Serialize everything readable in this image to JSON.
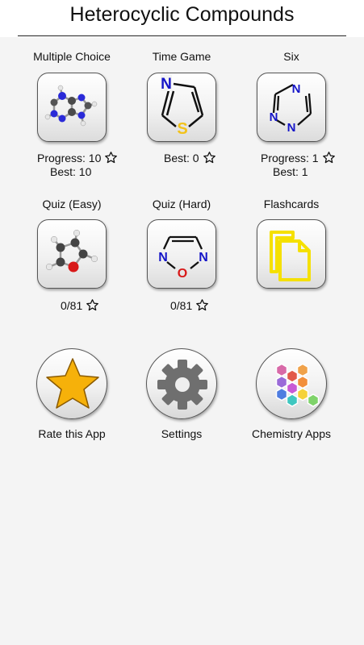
{
  "header": {
    "title": "Heterocyclic Compounds"
  },
  "games": [
    {
      "label": "Multiple Choice",
      "icon": "purine-molecule-icon",
      "progress": "Progress: 10",
      "best": "Best: 10"
    },
    {
      "label": "Time Game",
      "icon": "thiazole-structure-icon",
      "best": "Best: 0"
    },
    {
      "label": "Six",
      "icon": "triazine-structure-icon",
      "progress": "Progress: 1",
      "best": "Best: 1"
    },
    {
      "label": "Quiz (Easy)",
      "icon": "furan-molecule-icon",
      "score": "0/81"
    },
    {
      "label": "Quiz (Hard)",
      "icon": "oxadiazole-structure-icon",
      "score": "0/81"
    },
    {
      "label": "Flashcards",
      "icon": "flashcards-icon"
    }
  ],
  "actions": [
    {
      "label": "Rate this App",
      "icon": "star-icon"
    },
    {
      "label": "Settings",
      "icon": "gear-icon"
    },
    {
      "label": "Chemistry Apps",
      "icon": "hexagons-icon"
    }
  ],
  "structure_atoms": {
    "N": "N",
    "S": "S",
    "O": "O"
  },
  "colors": {
    "nitrogen": "#1515c8",
    "sulfur": "#f2c21a",
    "oxygen": "#d81818",
    "flashcard": "#f5e000",
    "star": "#f6b10a",
    "gear": "#6f6f6f"
  }
}
